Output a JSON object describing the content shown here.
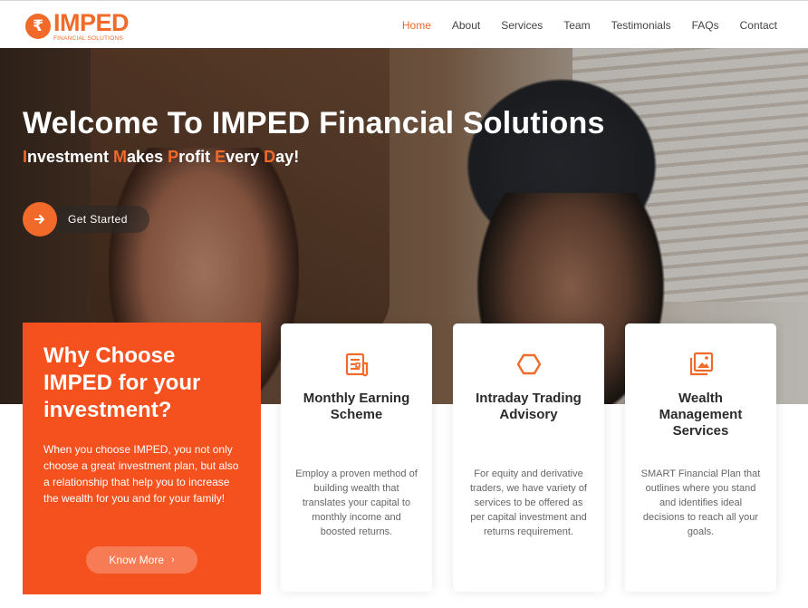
{
  "header": {
    "logo_icon": "₹",
    "logo_main": "IMPED",
    "logo_sub": "FINANCIAL SOLUTIONS",
    "nav": [
      "Home",
      "About",
      "Services",
      "Team",
      "Testimonials",
      "FAQs",
      "Contact"
    ],
    "active_nav": "Home"
  },
  "hero": {
    "title": "Welcome To IMPED Financial Solutions",
    "subtitle_parts": [
      {
        "hl": "I",
        "rest": "nvestment "
      },
      {
        "hl": "M",
        "rest": "akes "
      },
      {
        "hl": "P",
        "rest": "rofit "
      },
      {
        "hl": "E",
        "rest": "very "
      },
      {
        "hl": "D",
        "rest": "ay!"
      }
    ],
    "cta_icon": "arrow-right-icon",
    "cta_label": "Get Started"
  },
  "why": {
    "title": "Why Choose IMPED for your investment?",
    "text": "When you choose IMPED, you not only choose a great investment plan, but also a relationship that help you to increase the wealth for you and for your family!",
    "button_label": "Know More",
    "button_icon": "›"
  },
  "services": [
    {
      "icon": "document-icon",
      "title": "Monthly Earning Scheme",
      "text": "Employ a proven method of building wealth that translates your capital to monthly income and boosted returns."
    },
    {
      "icon": "hexagon-icon",
      "title": "Intraday Trading Advisory",
      "text": "For equity and derivative traders, we have variety of services to be offered as per capital investment and returns requirement."
    },
    {
      "icon": "images-icon",
      "title": "Wealth Management Services",
      "text": "SMART Financial Plan that outlines where you stand and identifies ideal decisions to reach all your goals."
    }
  ],
  "colors": {
    "accent": "#f26a2a",
    "why_bg": "#f4511e"
  }
}
